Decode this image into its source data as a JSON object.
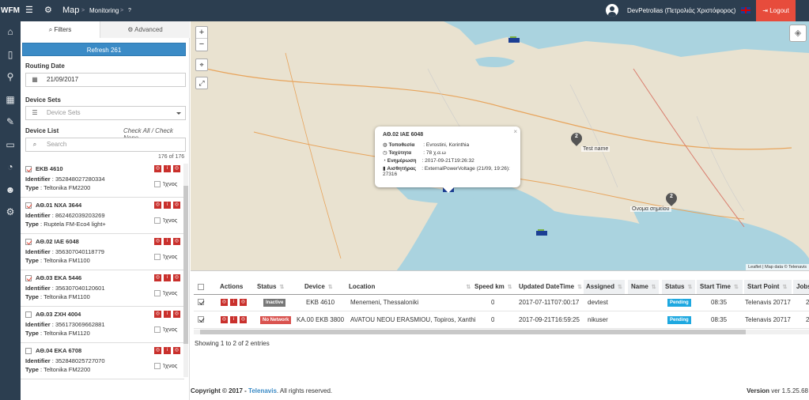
{
  "app": {
    "logo": "WFM",
    "title": "Map",
    "crumb_sep1": ">",
    "crumb": "Monitoring",
    "crumb_sep2": ">",
    "crumb_extra": "?"
  },
  "user": {
    "name": "DevPetrolias (Πετρολιάς Χριστόφορος)",
    "logout_label": "Logout"
  },
  "colors": {
    "topbar": "#2c3e50",
    "logout": "#e74c3c",
    "refresh": "#3b8bc6",
    "action_btn": "#c9302c",
    "pending": "#1ea8e0"
  },
  "filters": {
    "tab_filters": "Filters",
    "tab_advanced": "Advanced",
    "refresh_label": "Refresh 261",
    "routing_date_label": "Routing Date",
    "routing_date_value": "21/09/2017",
    "device_sets_label": "Device Sets",
    "device_sets_placeholder": "Device Sets",
    "device_list_label": "Device List",
    "check_links": "Check All / Check None",
    "search_placeholder": "Search",
    "count_shown": "176",
    "count_of": "of",
    "count_total": "176"
  },
  "devices": [
    {
      "name": "ΕΚΒ 4610",
      "checked": true,
      "identifier": "352848027280334",
      "type": "Teltonika FM2200",
      "track_label": "Ίχνος"
    },
    {
      "name": "ΑΘ.01 ΝΧΑ 3644",
      "checked": true,
      "identifier": "862462039203269",
      "type": "Ruptela FM-Eco4 light+",
      "track_label": "Ίχνος"
    },
    {
      "name": "ΑΘ.02 ΙΑΕ 6048",
      "checked": true,
      "identifier": "356307040118779",
      "type": "Teltonika FM1100",
      "track_label": "Ίχνος"
    },
    {
      "name": "ΑΘ.03 ΕΚΑ 5446",
      "checked": true,
      "identifier": "356307040120601",
      "type": "Teltonika FM1100",
      "track_label": "Ίχνος"
    },
    {
      "name": "ΑΘ.03 ΖΧΗ 4004",
      "checked": false,
      "identifier": "356173069662881",
      "type": "Teltonika FM1120",
      "track_label": "Ίχνος"
    },
    {
      "name": "ΑΘ.04 ΕΚΑ 6708",
      "checked": false,
      "identifier": "352848025727070",
      "type": "Teltonika FM2200",
      "track_label": "Ίχνος"
    }
  ],
  "device_labels": {
    "identifier": "Identifier",
    "type": "Type",
    "sep": ":"
  },
  "map": {
    "zoom_in": "+",
    "zoom_out": "−",
    "popup": {
      "title": "ΑΘ.02 ΙΑΕ 6048",
      "location_label": "Τοποθεσία",
      "location_value": "Evrostini, Korinthia",
      "speed_label": "Ταχύτητα",
      "speed_value": "78 χ.α.ω",
      "updated_label": "Ενημέρωση",
      "updated_value": "2017-09-21T19:26:32",
      "sensors_label": "Αισθητήρας",
      "sensors_value": "ExternalPowerVoltage (21/09, 19:26): 27316",
      "close": "×"
    },
    "markers": [
      {
        "count": "2",
        "label": "Test name"
      },
      {
        "count": "2",
        "label": "Ονομα σημείου"
      }
    ],
    "attribution": "Leaflet | Map data © Telenavis"
  },
  "grid": {
    "headers": [
      "Actions",
      "Status",
      "Device",
      "Location",
      "Speed km",
      "Updated DateTime",
      "Assigned",
      "Name",
      "Status",
      "Start Time",
      "Start Point",
      "Jobs"
    ],
    "rows": [
      {
        "status": "Inactive",
        "status_color": "grey",
        "device": "ΕΚΒ 4610",
        "location": "Menemeni, Thessaloniki",
        "speed": "0",
        "updated": "2017-07-11T07:00:17",
        "assigned": "devtest",
        "name": "",
        "job_status": "Pending",
        "start_time": "08:35",
        "start_point": "Telenavis 20717",
        "jobs": "2"
      },
      {
        "status": "No Network",
        "status_color": "red",
        "device": "ΚΑ.00 ΕΚΒ 3800",
        "location": "AVATOU NEOU ERASMIOU, Topiros, Xanthi",
        "speed": "0",
        "updated": "2017-09-21T16:59:25",
        "assigned": "nikuser",
        "name": "",
        "job_status": "Pending",
        "start_time": "08:35",
        "start_point": "Telenavis 20717",
        "jobs": "2"
      }
    ],
    "showing": "Showing 1 to 2 of 2 entries"
  },
  "footer": {
    "copyright_prefix": "Copyright © 2017 - ",
    "brand": "Telenavis",
    "copyright_suffix": ". All rights reserved.",
    "version_label": "Version",
    "version_value": "ver 1.5.25.68"
  }
}
